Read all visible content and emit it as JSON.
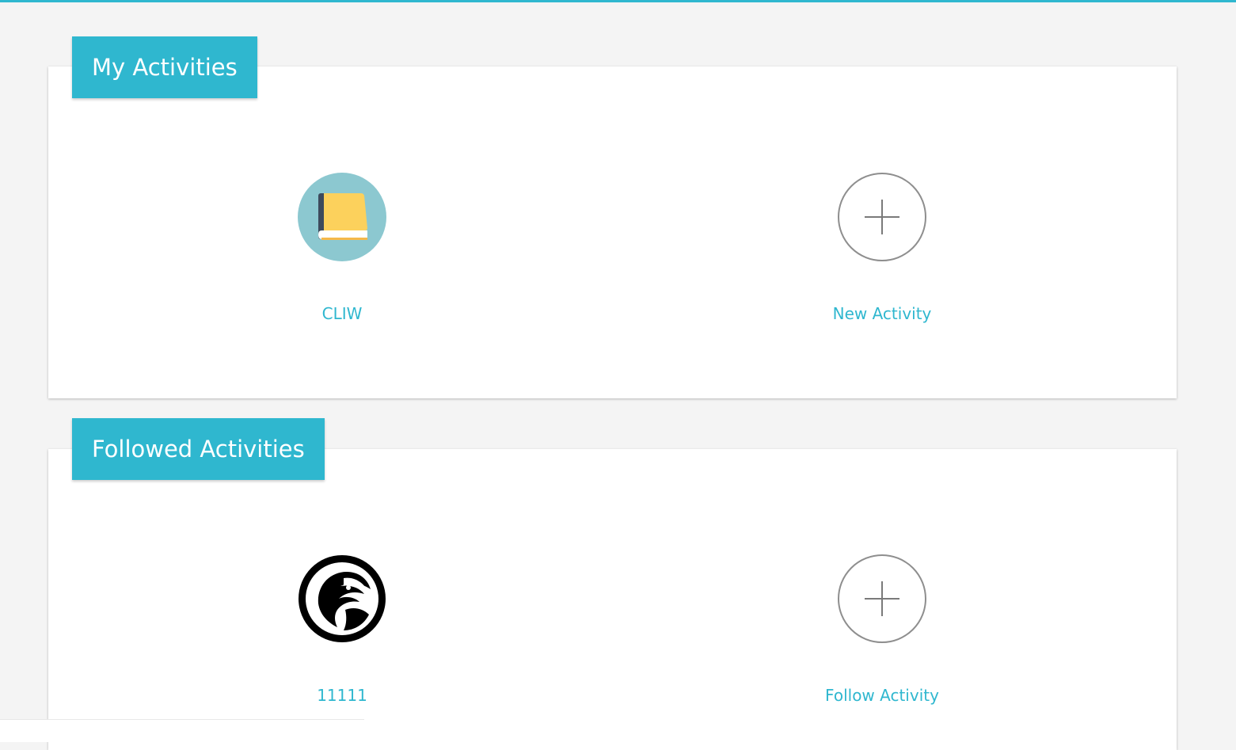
{
  "colors": {
    "accent": "#2fb7cf",
    "background": "#f4f4f4",
    "card": "#ffffff",
    "plus_icon": "#8e8e8e"
  },
  "my_activities": {
    "title": "My Activities",
    "items": [
      {
        "label": "CLIW",
        "icon": "book-icon"
      }
    ],
    "add_label": "New Activity",
    "add_icon": "plus-circle-icon"
  },
  "followed_activities": {
    "title": "Followed Activities",
    "items": [
      {
        "label": "11111",
        "icon": "eagle-logo-icon"
      }
    ],
    "add_label": "Follow Activity",
    "add_icon": "plus-circle-icon"
  }
}
